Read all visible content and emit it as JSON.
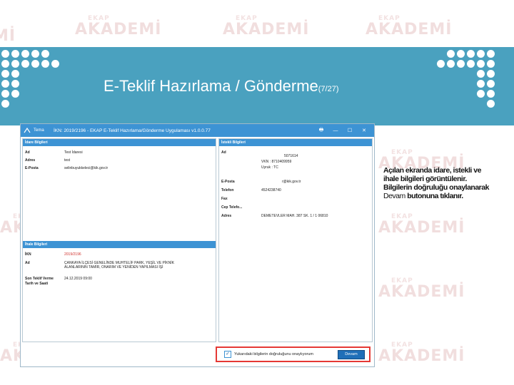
{
  "watermark": {
    "brand": "AKADEMİ",
    "badge": "EKAP"
  },
  "slide": {
    "title": "E-Teklif Hazırlama /  Gönderme",
    "page": "(7/27)"
  },
  "window": {
    "app_name": "Tema",
    "title": "İKN: 2019/2196 - EKAP E-Teklif Hazırlama/Gönderme Uygulaması v1.0.0.77",
    "buttons": {
      "print": "🖶",
      "minimize": "—",
      "maximize": "☐",
      "close": "✕"
    }
  },
  "idare": {
    "heading": "İdare Bilgileri",
    "rows": [
      {
        "key": "Ad",
        "value": "Test İdaresi"
      },
      {
        "key": "Adres",
        "value": "test"
      },
      {
        "key": "E-Posta",
        "value": "selinbuyukkeleci@kik.gov.tr"
      }
    ]
  },
  "istekli": {
    "heading": "İstekli Bilgileri",
    "ad_key": "Ad",
    "ad_lines": [
      "5071614",
      "VKN : 8710409959",
      "Uyruk : TC"
    ],
    "rows": [
      {
        "key": "E-Posta",
        "value": "r@kik.gov.tr"
      },
      {
        "key": "Telefon",
        "value": "4524238740"
      },
      {
        "key": "Fax",
        "value": ""
      },
      {
        "key": "Cep Telefo...",
        "value": ""
      },
      {
        "key": "Adres",
        "value": "DEMETEVLER MAH. 387 SK. 1 / 1 06810"
      }
    ]
  },
  "ihale": {
    "heading": "İhale Bilgileri",
    "ikn_key": "İKN",
    "ikn_value": "2019/2196",
    "ad_key": "Ad",
    "ad_value_1": "ÇANKAYA İLÇESİ GENELİNDE MUHTELİF PARK, YEŞİL VE PİKNİK",
    "ad_value_2": "ALANLARININ TAMİR, ONARIM VE YENİDEN YAPILMASI İŞİ",
    "deadline_key_1": "Son Teklif Verme",
    "deadline_key_2": "Tarih ve Saati",
    "deadline_value": "24.12.2019 09:00"
  },
  "confirm": {
    "checkbox_label": "Yukarıdaki bilgilerin doğruluğunu onaylıyorum",
    "checked": true,
    "button_label": "Devam"
  },
  "note": {
    "bold_text": "Açılan ekranda idare, istekli ve ihale bilgileri görüntülenir. Bilgilerin doğruluğu onaylanarak",
    "normal_text": "Devam",
    "bold_tail": "butonuna tıklanır."
  },
  "colors": {
    "banner": "#4aa1bf",
    "window_bar": "#3d93d4",
    "highlight": "#e53935",
    "ikn_red": "#d0312d"
  }
}
